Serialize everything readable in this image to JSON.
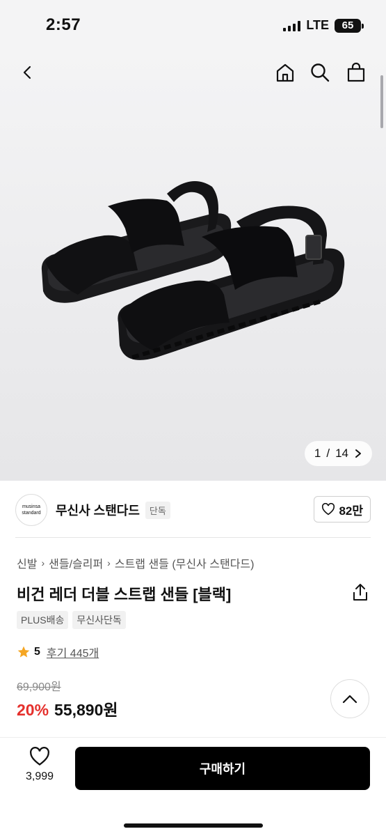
{
  "status_bar": {
    "time": "2:57",
    "network": "LTE",
    "battery": "65"
  },
  "nav": {
    "back_icon": "chevron-left-icon",
    "home_icon": "home-icon",
    "search_icon": "search-icon",
    "cart_icon": "shopping-bag-icon"
  },
  "gallery": {
    "current": "1",
    "separator": "/",
    "total": "14",
    "image": "black-double-strap-sandals"
  },
  "brand": {
    "logo_line1": "musinsa",
    "logo_line2": "standard",
    "name": "무신사 스탠다드",
    "badge": "단독",
    "likes": "82만"
  },
  "breadcrumb": [
    "신발",
    "샌들/슬리퍼",
    "스트랩 샌들 (무신사 스탠다드)"
  ],
  "product": {
    "title": "비건 레더 더블 스트랩 샌들 [블랙]",
    "tags": [
      "PLUS배송",
      "무신사단독"
    ],
    "rating": "5",
    "reviews": "후기 445개",
    "original_price": "69,900원",
    "discount": "20%",
    "sale_price": "55,890원"
  },
  "bottom_bar": {
    "wish_count": "3,999",
    "buy_label": "구매하기"
  },
  "colors": {
    "accent_red": "#e5302c",
    "button_black": "#000000",
    "star": "#f5a623"
  }
}
